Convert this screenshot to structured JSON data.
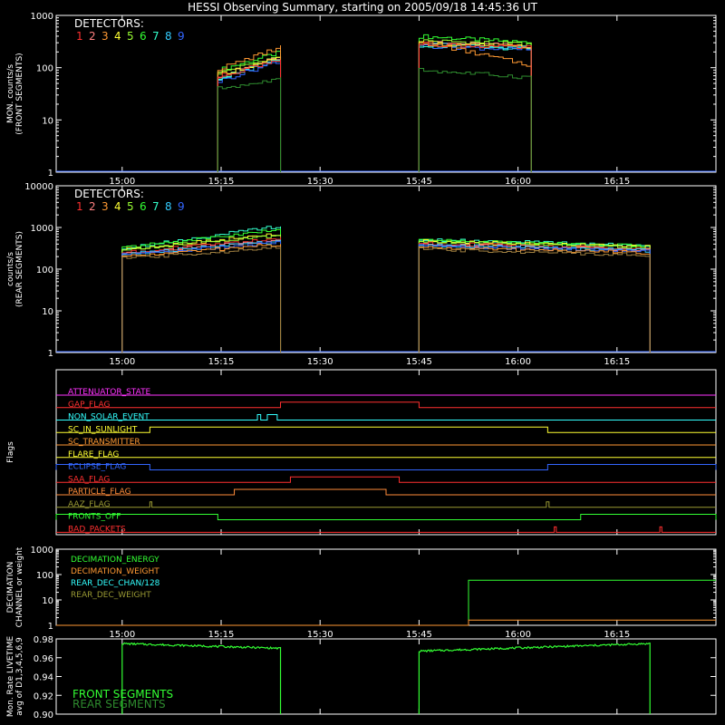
{
  "title": "HESSI Observing Summary, starting on 2005/09/18 14:45:36 UT",
  "time_ticks": [
    "15:00",
    "15:15",
    "15:30",
    "15:45",
    "16:00",
    "16:15"
  ],
  "detector_colors": [
    "#ff3030",
    "#ff8080",
    "#ff9933",
    "#ffff33",
    "#99ff33",
    "#33ff33",
    "#33ffcc",
    "#33ccff",
    "#3366ff"
  ],
  "chart_data": [
    {
      "type": "line",
      "id": "front",
      "ylabel": "MON. counts/s\n(FRONT SEGMENTS)",
      "yscale": "log",
      "ylim": [
        1,
        1000
      ],
      "yticks": [
        "1",
        "10",
        "100",
        "1000"
      ],
      "legend_title": "DETECTORS:",
      "legend_numbers": [
        "1",
        "2",
        "3",
        "4",
        "5",
        "6",
        "7",
        "8",
        "9"
      ],
      "series": [
        {
          "color": "#33ff33",
          "segments": [
            {
              "t": [
                14.5,
                24
              ],
              "v0": 90,
              "v1": 200
            },
            {
              "t": [
                45,
                62
              ],
              "v0": 400,
              "v1": 300
            }
          ]
        },
        {
          "color": "#99ff33",
          "segments": [
            {
              "t": [
                14.5,
                24
              ],
              "v0": 80,
              "v1": 170
            },
            {
              "t": [
                45,
                62
              ],
              "v0": 330,
              "v1": 280
            }
          ]
        },
        {
          "color": "#ff8080",
          "segments": [
            {
              "t": [
                14.5,
                24
              ],
              "v0": 70,
              "v1": 160
            },
            {
              "t": [
                45,
                62
              ],
              "v0": 300,
              "v1": 260
            }
          ]
        },
        {
          "color": "#33ccff",
          "segments": [
            {
              "t": [
                14.5,
                24
              ],
              "v0": 60,
              "v1": 150
            },
            {
              "t": [
                45,
                62
              ],
              "v0": 280,
              "v1": 240
            }
          ]
        },
        {
          "color": "#3366ff",
          "segments": [
            {
              "t": [
                14.5,
                24
              ],
              "v0": 55,
              "v1": 140
            },
            {
              "t": [
                45,
                62
              ],
              "v0": 260,
              "v1": 220
            }
          ]
        },
        {
          "color": "#33ffcc",
          "segments": [
            {
              "t": [
                14.5,
                24
              ],
              "v0": 65,
              "v1": 145
            },
            {
              "t": [
                45,
                62
              ],
              "v0": 270,
              "v1": 230
            }
          ]
        },
        {
          "color": "#ffff33",
          "segments": [
            {
              "t": [
                14.5,
                24
              ],
              "v0": 75,
              "v1": 155
            },
            {
              "t": [
                45,
                62
              ],
              "v0": 290,
              "v1": 250
            }
          ]
        },
        {
          "color": "#ff9933",
          "segments": [
            {
              "t": [
                14.5,
                24
              ],
              "v0": 95,
              "v1": 250
            },
            {
              "t": [
                45,
                62
              ],
              "v0": 320,
              "v1": 110
            }
          ]
        },
        {
          "color": "#ff3030",
          "segments": [
            {
              "t": [
                14.5,
                24
              ],
              "v0": 68,
              "v1": 150
            },
            {
              "t": [
                45,
                62
              ],
              "v0": 285,
              "v1": 240
            }
          ]
        },
        {
          "color": "#2e8b2e",
          "segments": [
            {
              "t": [
                14.5,
                24
              ],
              "v0": 40,
              "v1": 60
            },
            {
              "t": [
                45,
                62
              ],
              "v0": 90,
              "v1": 65
            }
          ]
        }
      ]
    },
    {
      "type": "line",
      "id": "rear",
      "ylabel": "counts/s\n(REAR SEGMENTS)",
      "yscale": "log",
      "ylim": [
        1,
        10000
      ],
      "yticks": [
        "1",
        "10",
        "100",
        "1000",
        "10000"
      ],
      "legend_title": "DETECTORS:",
      "legend_numbers": [
        "1",
        "2",
        "3",
        "4",
        "5",
        "6",
        "7",
        "8",
        "9"
      ],
      "series": [
        {
          "color": "#33ffcc",
          "segments": [
            {
              "t": [
                0,
                24
              ],
              "v0": 320,
              "v1": 1100
            },
            {
              "t": [
                45,
                80
              ],
              "v0": 520,
              "v1": 370
            }
          ]
        },
        {
          "color": "#33ff33",
          "segments": [
            {
              "t": [
                0,
                24
              ],
              "v0": 330,
              "v1": 900
            },
            {
              "t": [
                45,
                80
              ],
              "v0": 500,
              "v1": 360
            }
          ]
        },
        {
          "color": "#ffff33",
          "segments": [
            {
              "t": [
                0,
                24
              ],
              "v0": 300,
              "v1": 700
            },
            {
              "t": [
                45,
                80
              ],
              "v0": 480,
              "v1": 340
            }
          ]
        },
        {
          "color": "#99ff33",
          "segments": [
            {
              "t": [
                0,
                24
              ],
              "v0": 290,
              "v1": 650
            },
            {
              "t": [
                45,
                80
              ],
              "v0": 460,
              "v1": 330
            }
          ]
        },
        {
          "color": "#ff3030",
          "segments": [
            {
              "t": [
                0,
                24
              ],
              "v0": 250,
              "v1": 560
            },
            {
              "t": [
                45,
                80
              ],
              "v0": 420,
              "v1": 300
            }
          ]
        },
        {
          "color": "#ff8080",
          "segments": [
            {
              "t": [
                0,
                24
              ],
              "v0": 240,
              "v1": 500
            },
            {
              "t": [
                45,
                80
              ],
              "v0": 400,
              "v1": 290
            }
          ]
        },
        {
          "color": "#33ccff",
          "segments": [
            {
              "t": [
                0,
                24
              ],
              "v0": 230,
              "v1": 470
            },
            {
              "t": [
                45,
                80
              ],
              "v0": 380,
              "v1": 280
            }
          ]
        },
        {
          "color": "#3366ff",
          "segments": [
            {
              "t": [
                0,
                24
              ],
              "v0": 220,
              "v1": 440
            },
            {
              "t": [
                45,
                80
              ],
              "v0": 360,
              "v1": 270
            }
          ]
        },
        {
          "color": "#ff9933",
          "segments": [
            {
              "t": [
                0,
                24
              ],
              "v0": 200,
              "v1": 400
            },
            {
              "t": [
                45,
                80
              ],
              "v0": 330,
              "v1": 250
            }
          ]
        },
        {
          "color": "#a08040",
          "segments": [
            {
              "t": [
                0,
                24
              ],
              "v0": 180,
              "v1": 330
            },
            {
              "t": [
                45,
                80
              ],
              "v0": 300,
              "v1": 220
            }
          ]
        }
      ]
    },
    {
      "type": "line",
      "id": "flags",
      "ylabel": "Flags",
      "flags": [
        {
          "name": "ATTENUATOR_STATE",
          "color": "#ff33ff",
          "high": []
        },
        {
          "name": "GAP_FLAG",
          "color": "#ff3030",
          "high": [
            [
              24,
              45
            ]
          ]
        },
        {
          "name": "NON_SOLAR_EVENT",
          "color": "#33ffff",
          "high": [
            [
              20.5,
              21
            ],
            [
              22,
              23.5
            ]
          ]
        },
        {
          "name": "SC_IN_SUNLIGHT",
          "color": "#ffff33",
          "high": [
            [
              4.2,
              64.5
            ]
          ],
          "state": "high-outside-low"
        },
        {
          "name": "SC_TRANSMITTER",
          "color": "#ff9933",
          "high": []
        },
        {
          "name": "FLARE_FLAG",
          "color": "#ffff33",
          "high": []
        },
        {
          "name": "ECLIPSE_FLAG",
          "color": "#3366ff",
          "high": [
            [
              -10,
              4.2
            ],
            [
              64.5,
              90
            ]
          ]
        },
        {
          "name": "SAA_FLAG",
          "color": "#ff3030",
          "high": [
            [
              25.5,
              42
            ]
          ]
        },
        {
          "name": "PARTICLE_FLAG",
          "color": "#ff8c3a",
          "high": [
            [
              17,
              40
            ]
          ]
        },
        {
          "name": "AAZ_FLAG",
          "color": "#999933",
          "high": [
            [
              4.2,
              4.5
            ],
            [
              64.3,
              64.7
            ]
          ]
        },
        {
          "name": "FRONTS_OFF",
          "color": "#33ff33",
          "high": [
            [
              -10,
              14.5
            ],
            [
              69.5,
              90
            ]
          ]
        },
        {
          "name": "BAD_PACKETS",
          "color": "#ff3030",
          "high": [
            [
              65.5,
              65.8
            ],
            [
              81.5,
              81.8
            ]
          ]
        }
      ]
    },
    {
      "type": "line",
      "id": "decimation",
      "ylabel": "DECIMATION\nCHANNEL or weight",
      "yscale": "log",
      "ylim": [
        1,
        1000
      ],
      "yticks": [
        "1",
        "10",
        "100",
        "1000"
      ],
      "legend": [
        {
          "label": "DECIMATION_ENERGY",
          "color": "#33ff33"
        },
        {
          "label": "DECIMATION_WEIGHT",
          "color": "#ff9933"
        },
        {
          "label": "REAR_DEC_CHAN/128",
          "color": "#33ffff"
        },
        {
          "label": "REAR_DEC_WEIGHT",
          "color": "#999933"
        }
      ],
      "series": [
        {
          "name": "DECIMATION_ENERGY",
          "color": "#33ff33",
          "steps": [
            [
              -10,
              1
            ],
            [
              52.5,
              60
            ],
            [
              90,
              60
            ]
          ]
        },
        {
          "name": "DECIMATION_WEIGHT",
          "color": "#ff9933",
          "steps": [
            [
              -10,
              1
            ],
            [
              52.5,
              1.6
            ],
            [
              90,
              1.6
            ]
          ]
        }
      ]
    },
    {
      "type": "line",
      "id": "livetime",
      "ylabel": "Mon. Rate LIVETIME\navg of D1,3,4,5,6,9",
      "ylim": [
        0.9,
        0.98
      ],
      "yticks": [
        "0.90",
        "0.92",
        "0.94",
        "0.96",
        "0.98"
      ],
      "legend": [
        {
          "label": "FRONT SEGMENTS",
          "color": "#33ff33"
        },
        {
          "label": "REAR SEGMENTS",
          "color": "#2e8b2e"
        }
      ],
      "series": [
        {
          "name": "FRONT SEGMENTS",
          "color": "#33ff33",
          "segments": [
            {
              "t": [
                0,
                24
              ],
              "v0": 0.975,
              "v1": 0.97
            },
            {
              "t": [
                45,
                80
              ],
              "v0": 0.967,
              "v1": 0.975
            }
          ]
        }
      ]
    }
  ]
}
